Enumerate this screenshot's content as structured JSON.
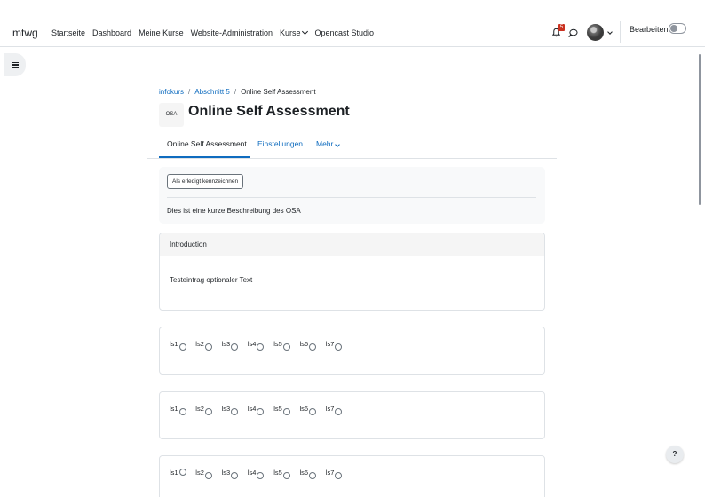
{
  "navbar": {
    "brand": "mtwg",
    "items": [
      {
        "label": "Startseite"
      },
      {
        "label": "Dashboard"
      },
      {
        "label": "Meine Kurse"
      },
      {
        "label": "Website-Administration"
      },
      {
        "label": "Kurse",
        "dropdown": true
      },
      {
        "label": "Opencast Studio"
      }
    ],
    "notification_count": "5",
    "edit_label": "Bearbeiten"
  },
  "breadcrumb": {
    "items": [
      "infokurs",
      "Abschnitt 5",
      "Online Self Assessment"
    ],
    "separator": "/"
  },
  "header": {
    "icon_text": "OSA",
    "title": "Online Self Assessment"
  },
  "tabs": {
    "items": [
      "Online Self Assessment",
      "Einstellungen",
      "Mehr"
    ]
  },
  "activity": {
    "done_button": "Als erledigt kennzeichnen",
    "description": "Dies ist eine kurze Beschreibung des OSA"
  },
  "intro_card": {
    "header": "Introduction",
    "body": "Testeintrag optionaler Text"
  },
  "radio_groups": [
    {
      "options": [
        "ls1",
        "ls2",
        "ls3",
        "ls4",
        "ls5",
        "ls6",
        "ls7"
      ]
    },
    {
      "options": [
        "ls1",
        "ls2",
        "ls3",
        "ls4",
        "ls5",
        "ls6",
        "ls7"
      ]
    },
    {
      "options": [
        "ls1",
        "ls2",
        "ls3",
        "ls4",
        "ls5",
        "ls6",
        "ls7"
      ]
    }
  ],
  "help_label": "?",
  "colors": {
    "link": "#0f6cbf",
    "badge": "#ca3120",
    "text": "#1d2125"
  }
}
